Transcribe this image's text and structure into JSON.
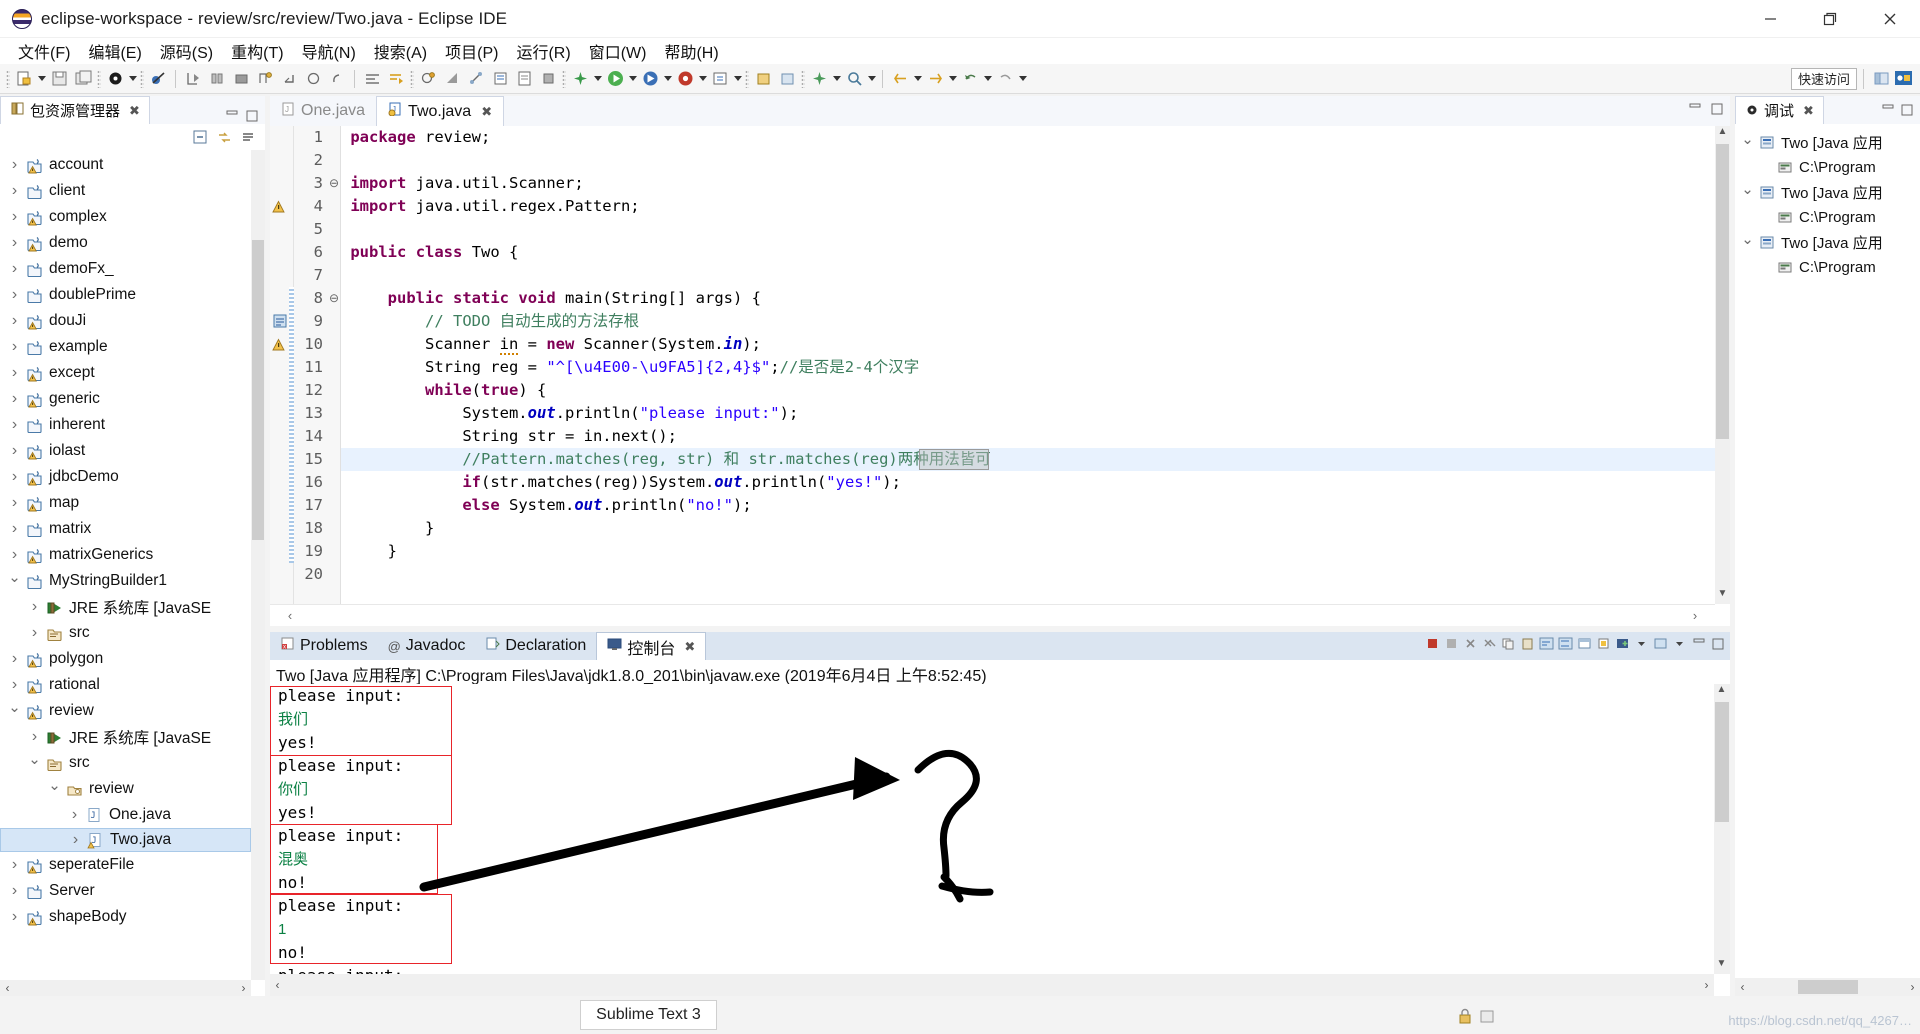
{
  "window": {
    "title": "eclipse-workspace - review/src/review/Two.java - Eclipse IDE",
    "minimize_label": "minimize-icon",
    "maximize_label": "restore-icon",
    "close_label": "close-icon"
  },
  "menubar": {
    "items": [
      {
        "label": "文件(F)"
      },
      {
        "label": "编辑(E)"
      },
      {
        "label": "源码(S)"
      },
      {
        "label": "重构(T)"
      },
      {
        "label": "导航(N)"
      },
      {
        "label": "搜索(A)"
      },
      {
        "label": "项目(P)"
      },
      {
        "label": "运行(R)"
      },
      {
        "label": "窗口(W)"
      },
      {
        "label": "帮助(H)"
      }
    ]
  },
  "toolbar": {
    "quick_access": "快速访问",
    "icons": [
      "new-file-icon",
      "save-icon",
      "save-all-icon",
      "debug-icon",
      "external-tools-icon",
      "skip-breakpoints-icon",
      "step-over-icon",
      "resume-icon",
      "terminate-icon",
      "new-class-icon",
      "search-icon",
      "run-icon",
      "coverage-icon",
      "run-last-icon",
      "profile-icon",
      "open-type-icon",
      "next-annotation-icon",
      "previous-annotation-icon",
      "back-icon",
      "forward-icon"
    ]
  },
  "package_explorer": {
    "tab_label": "包资源管理器",
    "toolbar_icons": [
      "collapse-all-icon",
      "link-with-editor-icon",
      "view-menu-icon",
      "minimize-icon",
      "maximize-icon"
    ],
    "items": [
      {
        "label": "account",
        "indent": 0,
        "state": "closed",
        "icon": "java-project-warn-icon"
      },
      {
        "label": "client",
        "indent": 0,
        "state": "closed",
        "icon": "java-project-icon"
      },
      {
        "label": "complex",
        "indent": 0,
        "state": "closed",
        "icon": "java-project-warn-icon"
      },
      {
        "label": "demo",
        "indent": 0,
        "state": "closed",
        "icon": "java-project-warn-icon"
      },
      {
        "label": "demoFx_",
        "indent": 0,
        "state": "closed",
        "icon": "java-project-icon"
      },
      {
        "label": "doublePrime",
        "indent": 0,
        "state": "closed",
        "icon": "java-project-icon"
      },
      {
        "label": "douJi",
        "indent": 0,
        "state": "closed",
        "icon": "java-project-warn-icon"
      },
      {
        "label": "example",
        "indent": 0,
        "state": "closed",
        "icon": "java-project-icon"
      },
      {
        "label": "except",
        "indent": 0,
        "state": "closed",
        "icon": "java-project-warn-icon"
      },
      {
        "label": "generic",
        "indent": 0,
        "state": "closed",
        "icon": "java-project-warn-icon"
      },
      {
        "label": "inherent",
        "indent": 0,
        "state": "closed",
        "icon": "java-project-icon"
      },
      {
        "label": "iolast",
        "indent": 0,
        "state": "closed",
        "icon": "java-project-warn-icon"
      },
      {
        "label": "jdbcDemo",
        "indent": 0,
        "state": "closed",
        "icon": "java-project-warn-icon"
      },
      {
        "label": "map",
        "indent": 0,
        "state": "closed",
        "icon": "java-project-warn-icon"
      },
      {
        "label": "matrix",
        "indent": 0,
        "state": "closed",
        "icon": "java-project-icon"
      },
      {
        "label": "matrixGenerics",
        "indent": 0,
        "state": "closed",
        "icon": "java-project-warn-icon"
      },
      {
        "label": "MyStringBuilder1",
        "indent": 0,
        "state": "open",
        "icon": "java-project-icon"
      },
      {
        "label": "JRE 系统库 [JavaSE",
        "indent": 1,
        "state": "closed",
        "icon": "jre-library-icon"
      },
      {
        "label": "src",
        "indent": 1,
        "state": "closed",
        "icon": "source-folder-icon"
      },
      {
        "label": "polygon",
        "indent": 0,
        "state": "closed",
        "icon": "java-project-warn-icon"
      },
      {
        "label": "rational",
        "indent": 0,
        "state": "closed",
        "icon": "java-project-warn-icon"
      },
      {
        "label": "review",
        "indent": 0,
        "state": "open",
        "icon": "java-project-warn-icon"
      },
      {
        "label": "JRE 系统库 [JavaSE",
        "indent": 1,
        "state": "closed",
        "icon": "jre-library-icon"
      },
      {
        "label": "src",
        "indent": 1,
        "state": "open",
        "icon": "source-folder-icon"
      },
      {
        "label": "review",
        "indent": 2,
        "state": "open",
        "icon": "package-icon"
      },
      {
        "label": "One.java",
        "indent": 3,
        "state": "closed",
        "icon": "java-file-icon"
      },
      {
        "label": "Two.java",
        "indent": 3,
        "state": "closed",
        "icon": "java-file-warn-icon",
        "selected": true
      },
      {
        "label": "seperateFile",
        "indent": 0,
        "state": "closed",
        "icon": "java-project-warn-icon"
      },
      {
        "label": "Server",
        "indent": 0,
        "state": "closed",
        "icon": "java-project-icon"
      },
      {
        "label": "shapeBody",
        "indent": 0,
        "state": "closed",
        "icon": "java-project-warn-icon"
      }
    ]
  },
  "editor": {
    "tabs": [
      {
        "label": "One.java",
        "active": false,
        "icon": "java-file-icon",
        "closable": false
      },
      {
        "label": "Two.java",
        "active": true,
        "icon": "java-file-warn-icon",
        "closable": true
      }
    ],
    "tab_tools": [
      "minimize-icon",
      "maximize-icon"
    ],
    "first_line": 1,
    "last_line": 20,
    "highlighted_line": 15,
    "lines": [
      {
        "n": 1,
        "fold": "",
        "marker": "",
        "text": "package review;"
      },
      {
        "n": 2,
        "fold": "",
        "marker": "",
        "text": ""
      },
      {
        "n": 3,
        "fold": "-",
        "marker": "",
        "text": "import java.util.Scanner;"
      },
      {
        "n": 4,
        "fold": "",
        "marker": "warn",
        "text": "import java.util.regex.Pattern;"
      },
      {
        "n": 5,
        "fold": "",
        "marker": "",
        "text": ""
      },
      {
        "n": 6,
        "fold": "",
        "marker": "",
        "text": "public class Two {"
      },
      {
        "n": 7,
        "fold": "",
        "marker": "",
        "text": ""
      },
      {
        "n": 8,
        "fold": "-",
        "marker": "",
        "text": "    public static void main(String[] args) {"
      },
      {
        "n": 9,
        "fold": "",
        "marker": "todo",
        "text": "        // TODO 自动生成的方法存根"
      },
      {
        "n": 10,
        "fold": "",
        "marker": "warn",
        "text": "        Scanner in = new Scanner(System.in);"
      },
      {
        "n": 11,
        "fold": "",
        "marker": "",
        "text": "        String reg = \"^[\\u4E00-\\u9FA5]{2,4}$\";//是否是2-4个汉字"
      },
      {
        "n": 12,
        "fold": "",
        "marker": "",
        "text": "        while(true) {"
      },
      {
        "n": 13,
        "fold": "",
        "marker": "",
        "text": "            System.out.println(\"please input:\");"
      },
      {
        "n": 14,
        "fold": "",
        "marker": "",
        "text": "            String str = in.next();"
      },
      {
        "n": 15,
        "fold": "",
        "marker": "",
        "text": "            //Pattern.matches(reg, str) 和 str.matches(reg)两种用法皆可"
      },
      {
        "n": 16,
        "fold": "",
        "marker": "",
        "text": "            if(str.matches(reg))System.out.println(\"yes!\");"
      },
      {
        "n": 17,
        "fold": "",
        "marker": "",
        "text": "            else System.out.println(\"no!\");"
      },
      {
        "n": 18,
        "fold": "",
        "marker": "",
        "text": "        }"
      },
      {
        "n": 19,
        "fold": "",
        "marker": "",
        "text": "    }"
      },
      {
        "n": 20,
        "fold": "",
        "marker": "",
        "text": ""
      }
    ]
  },
  "console": {
    "tabs": [
      {
        "label": "Problems",
        "active": false,
        "icon": "problems-icon"
      },
      {
        "label": "Javadoc",
        "active": false,
        "icon": "javadoc-icon"
      },
      {
        "label": "Declaration",
        "active": false,
        "icon": "declaration-icon"
      },
      {
        "label": "控制台",
        "active": true,
        "icon": "console-icon",
        "closable": true
      }
    ],
    "launch_header": "Two [Java 应用程序] C:\\Program Files\\Java\\jdk1.8.0_201\\bin\\javaw.exe  (2019年6月4日 上午8:52:45)",
    "toolbar_icons": [
      "terminate-icon",
      "terminate-all-icon",
      "remove-launch-icon",
      "remove-all-icon",
      "open-console-icon",
      "copy-icon",
      "paste-icon",
      "word-wrap-icon",
      "scroll-lock-icon",
      "pin-console-icon",
      "display-console-icon",
      "new-console-icon",
      "menu-icon",
      "minimize-icon",
      "maximize-icon"
    ],
    "output": [
      {
        "text": "please input:",
        "kind": "out"
      },
      {
        "text": "我们",
        "kind": "in"
      },
      {
        "text": "yes!",
        "kind": "out"
      },
      {
        "text": "please input:",
        "kind": "out"
      },
      {
        "text": "你们",
        "kind": "in"
      },
      {
        "text": "yes!",
        "kind": "out"
      },
      {
        "text": "please input:",
        "kind": "out"
      },
      {
        "text": "混奥",
        "kind": "in"
      },
      {
        "text": "no!",
        "kind": "out"
      },
      {
        "text": "please input:",
        "kind": "out"
      },
      {
        "text": "1",
        "kind": "in"
      },
      {
        "text": "no!",
        "kind": "out"
      },
      {
        "text": "please input:",
        "kind": "out"
      }
    ],
    "annotation_boxes": 4,
    "annotation_color": "#e8242a"
  },
  "debug_view": {
    "tab_label": "调试",
    "tools": [
      "view-menu-icon",
      "minimize-icon",
      "maximize-icon"
    ],
    "items": [
      {
        "label": "Two [Java 应用",
        "indent": 0,
        "state": "open",
        "icon": "launch-icon"
      },
      {
        "label": "C:\\Program",
        "indent": 1,
        "state": "leaf",
        "icon": "process-icon"
      },
      {
        "label": "Two [Java 应用",
        "indent": 0,
        "state": "open",
        "icon": "launch-icon"
      },
      {
        "label": "C:\\Program",
        "indent": 1,
        "state": "leaf",
        "icon": "process-icon"
      },
      {
        "label": "Two [Java 应用",
        "indent": 0,
        "state": "open",
        "icon": "launch-icon"
      },
      {
        "label": "C:\\Program",
        "indent": 1,
        "state": "leaf",
        "icon": "process-icon"
      }
    ]
  },
  "statusbar": {
    "taskbar_chip": "Sublime Text 3",
    "lock_icon": "writable-lock-icon",
    "watermark": "https://blog.csdn.net/qq_4267…"
  },
  "colors": {
    "accent": "#2a00ff",
    "keyword": "#7f0055",
    "comment": "#3f7f5f",
    "annotation_red": "#e8242a",
    "console_input_green": "#0a8043",
    "selection_blue": "#d6e6f7"
  }
}
